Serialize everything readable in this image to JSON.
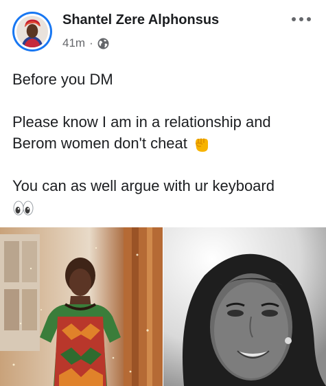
{
  "post": {
    "author": "Shantel Zere Alphonsus",
    "time": "41m",
    "separator": "·",
    "privacy_icon": "globe-icon",
    "more_icon": "more-dots-icon",
    "lines": {
      "line1": "Before you DM",
      "line2a": "Please know I am in a relationship and",
      "line2b": "Berom women don't cheat",
      "line2b_emoji": "raised-fist-emoji",
      "line3a": "You can as well argue with ur keyboard",
      "line3b_emoji": "eyes-emoji"
    },
    "photos": [
      {
        "name": "photo-woman-in-patterned-dress"
      },
      {
        "name": "photo-woman-black-and-white-selfie"
      }
    ]
  },
  "colors": {
    "accent": "#1877f2",
    "text": "#1c1e21",
    "meta": "#65676b"
  }
}
